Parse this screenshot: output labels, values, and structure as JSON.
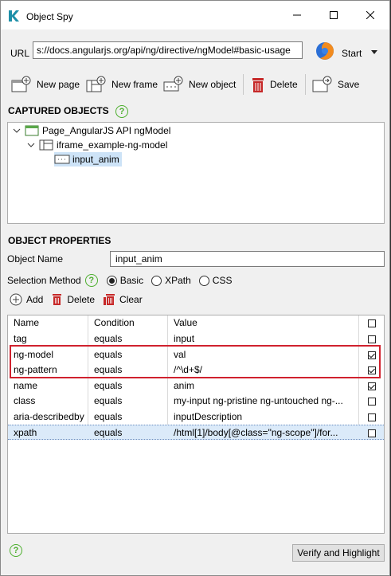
{
  "window": {
    "title": "Object Spy"
  },
  "url_bar": {
    "label": "URL",
    "value": "s://docs.angularjs.org/api/ng/directive/ngModel#basic-usage",
    "start_label": "Start"
  },
  "toolbar": {
    "new_page": "New page",
    "new_frame": "New frame",
    "new_object": "New object",
    "delete": "Delete",
    "save": "Save"
  },
  "captured_objects": {
    "title": "CAPTURED OBJECTS",
    "tree": [
      {
        "label": "Page_AngularJS API ngModel",
        "icon": "page-icon"
      },
      {
        "label": "iframe_example-ng-model",
        "icon": "frame-icon"
      },
      {
        "label": "input_anim",
        "icon": "input-object-icon",
        "selected": true
      }
    ]
  },
  "object_properties": {
    "title": "OBJECT PROPERTIES",
    "object_name_label": "Object Name",
    "object_name_value": "input_anim",
    "selection_method_label": "Selection Method",
    "methods": [
      "Basic",
      "XPath",
      "CSS"
    ],
    "selected_method": "Basic",
    "add_label": "Add",
    "delete_label": "Delete",
    "clear_label": "Clear"
  },
  "grid": {
    "headers": [
      "Name",
      "Condition",
      "Value"
    ],
    "rows": [
      {
        "name": "tag",
        "condition": "equals",
        "value": "input",
        "checked": false
      },
      {
        "name": "ng-model",
        "condition": "equals",
        "value": "val",
        "checked": true
      },
      {
        "name": "ng-pattern",
        "condition": "equals",
        "value": "/^\\d+$/",
        "checked": true
      },
      {
        "name": "name",
        "condition": "equals",
        "value": "anim",
        "checked": true
      },
      {
        "name": "class",
        "condition": "equals",
        "value": "my-input ng-pristine ng-untouched ng-...",
        "checked": false
      },
      {
        "name": "aria-describedby",
        "condition": "equals",
        "value": "inputDescription",
        "checked": false
      },
      {
        "name": "xpath",
        "condition": "equals",
        "value": "/html[1]/body[@class=\"ng-scope\"]/for...",
        "checked": false,
        "selected": true
      }
    ]
  },
  "footer": {
    "verify_label": "Verify and Highlight",
    "help_glyph": "?"
  },
  "colors": {
    "highlight": "#d0212e",
    "help_green": "#4caf2d",
    "delete_red": "#c62828",
    "selection_blue": "#dbeaf9"
  }
}
